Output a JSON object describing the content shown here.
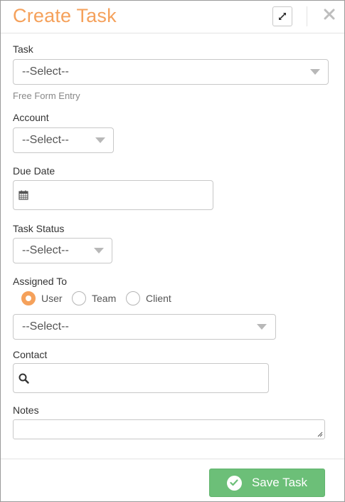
{
  "dialog": {
    "title": "Create Task"
  },
  "task": {
    "label": "Task",
    "value": "--Select--",
    "hint": "Free Form Entry"
  },
  "account": {
    "label": "Account",
    "value": "--Select--"
  },
  "due_date": {
    "label": "Due Date",
    "value": ""
  },
  "task_status": {
    "label": "Task Status",
    "value": "--Select--"
  },
  "assigned_to": {
    "label": "Assigned To",
    "options": [
      {
        "label": "User",
        "checked": true
      },
      {
        "label": "Team",
        "checked": false
      },
      {
        "label": "Client",
        "checked": false
      }
    ],
    "value": "--Select--"
  },
  "contact": {
    "label": "Contact",
    "value": ""
  },
  "notes": {
    "label": "Notes",
    "value": ""
  },
  "footer": {
    "save_label": "Save Task"
  },
  "colors": {
    "accent": "#f5a15b",
    "save_button": "#6cbf78"
  },
  "icons": [
    "expand-icon",
    "close-icon",
    "calendar-icon",
    "search-icon",
    "check-circle-icon",
    "resize-grip-icon"
  ]
}
